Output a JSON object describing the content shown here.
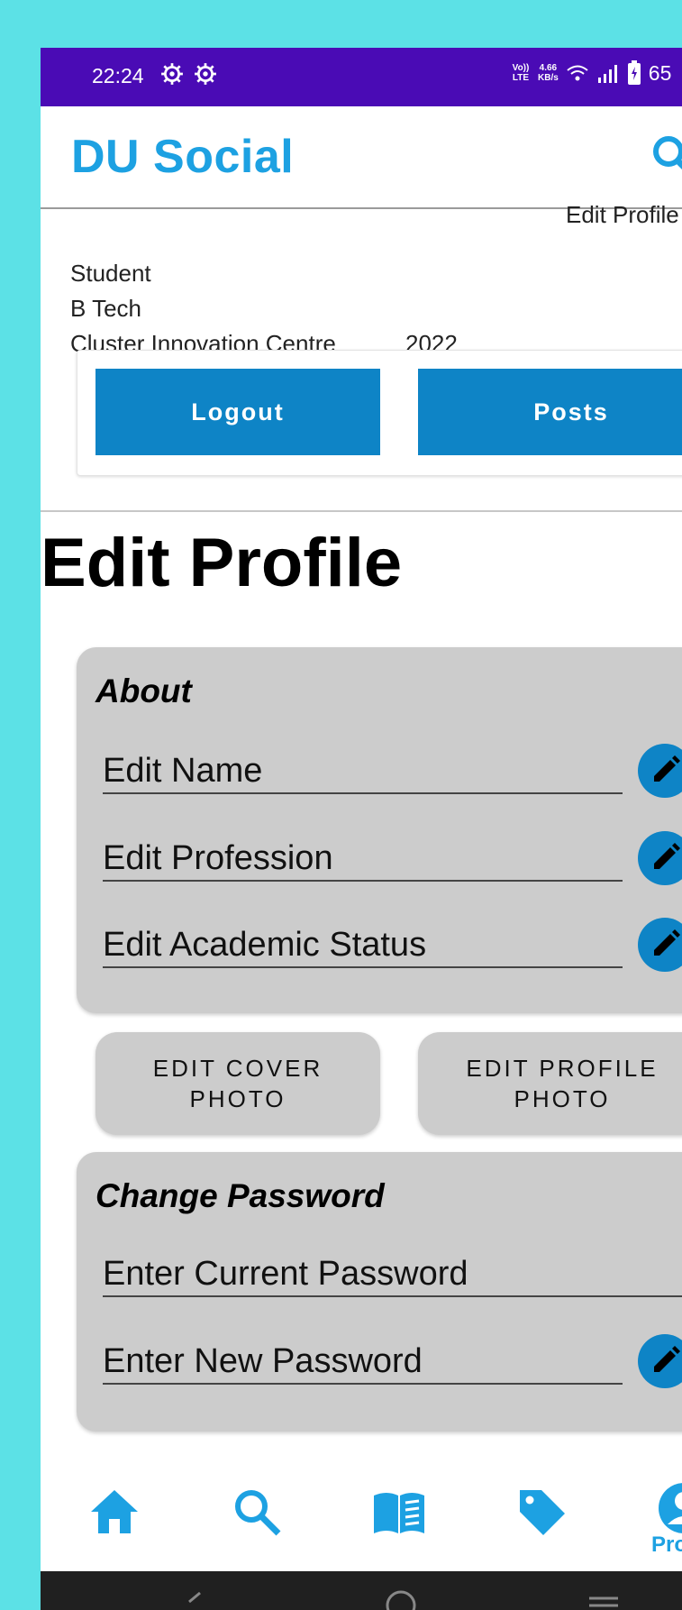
{
  "status_bar": {
    "time": "22:24",
    "volte": "Vo)) LTE",
    "speed_top": "4.66",
    "speed_bottom": "KB/s",
    "battery_text": "65"
  },
  "app": {
    "title": "DU Social"
  },
  "profile": {
    "role": "Student",
    "degree": "B Tech",
    "college": "Cluster Innovation Centre",
    "year": "2022",
    "edit_profile_link": "Edit Profile"
  },
  "actions": {
    "logout": "Logout",
    "posts": "Posts"
  },
  "page_title": "Edit Profile",
  "about": {
    "heading": "About",
    "name_placeholder": "Edit Name",
    "profession_placeholder": "Edit Profession",
    "academic_placeholder": "Edit Academic Status"
  },
  "photo_buttons": {
    "cover_line1": "EDIT COVER",
    "cover_line2": "PHOTO",
    "profile_line1": "EDIT PROFILE",
    "profile_line2": "PHOTO"
  },
  "password": {
    "heading": "Change Password",
    "current_placeholder": "Enter Current Password",
    "new_placeholder": "Enter New Password"
  },
  "bottom_nav": {
    "profile_label": "Pro"
  },
  "colors": {
    "background": "#5CE1E6",
    "status_bar": "#4A0BB5",
    "accent": "#1DA1E2",
    "button_blue": "#0E84C6",
    "card_gray": "#CCCCCC"
  },
  "icons": [
    "gear-icon",
    "search-icon",
    "pencil-icon",
    "home-icon",
    "book-icon",
    "tag-icon",
    "profile-icon"
  ]
}
